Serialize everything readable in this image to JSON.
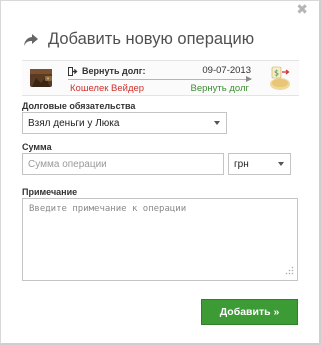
{
  "dialog": {
    "close_glyph": "✖",
    "title": "Добавить новую операцию",
    "title_icon": "share-arrow-icon"
  },
  "transfer": {
    "from_icon": "wallet-icon",
    "to_icon": "money-bag-icon",
    "operation_icon": "sign-out-icon",
    "operation_name": "Вернуть долг:",
    "date": "09-07-2013",
    "from": "Кошелек Вейдер",
    "to": "Вернуть долг",
    "from_color": "#d0312d",
    "to_color": "#3e8e34"
  },
  "form": {
    "debt_label": "Долговые обязательства",
    "debt_selected": "Взял деньги у Люка",
    "amount_label": "Сумма",
    "amount_value": "",
    "amount_placeholder": "Сумма операции",
    "currency_selected": "грн",
    "note_label": "Примечание",
    "note_value": "",
    "note_placeholder": "Введите примечание к операции"
  },
  "actions": {
    "add_label": "Добавить »",
    "add_color": "#3d9b35"
  }
}
